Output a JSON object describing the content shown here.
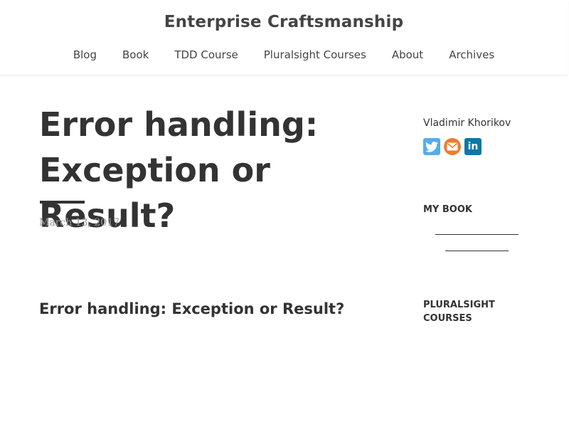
{
  "header": {
    "site_title": "Enterprise Craftsmanship",
    "nav": [
      {
        "label": "Blog"
      },
      {
        "label": "Book"
      },
      {
        "label": "TDD Course"
      },
      {
        "label": "Pluralsight Courses"
      },
      {
        "label": "About"
      },
      {
        "label": "Archives"
      }
    ]
  },
  "post": {
    "title": "Error handling: Exception or Result?",
    "date": "March 13, 2017",
    "section_heading": "Error handling: Exception or Result?"
  },
  "sidebar": {
    "author": "Vladimir Khorikov",
    "social_icons": [
      {
        "name": "twitter-icon",
        "color": "#55acee"
      },
      {
        "name": "email-icon",
        "color": "#ef7d2a"
      },
      {
        "name": "linkedin-icon",
        "color": "#0e76a8",
        "glyph": "in"
      }
    ],
    "my_book_title": "MY BOOK",
    "pluralsight_title": "PLURALSIGHT COURSES"
  }
}
